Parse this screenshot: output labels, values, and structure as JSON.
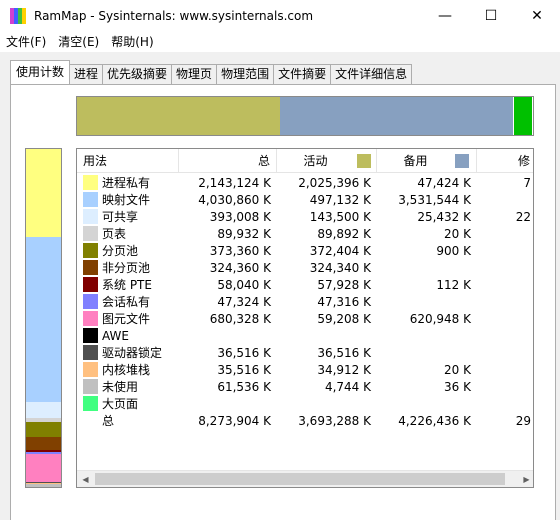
{
  "window": {
    "title": "RamMap - Sysinternals: www.sysinternals.com",
    "minimize": "—",
    "maximize": "☐",
    "close": "✕"
  },
  "menu": [
    "文件(F)",
    "清空(E)",
    "帮助(H)"
  ],
  "tabs": [
    "使用计数",
    "进程",
    "优先级摘要",
    "物理页",
    "物理范围",
    "文件摘要",
    "文件详细信息"
  ],
  "active_tab": 0,
  "grid": {
    "headers": {
      "usage": "用法",
      "total": "总",
      "active": "活动",
      "standby": "备用",
      "modified": "修"
    },
    "active_color": "#bdbd5e",
    "standby_color": "#87a0c0",
    "rows": [
      {
        "name": "进程私有",
        "color": "#ffff80",
        "total": "2,143,124 K",
        "active": "2,025,396 K",
        "standby": "47,424 K",
        "modified": "7"
      },
      {
        "name": "映射文件",
        "color": "#a8d0ff",
        "total": "4,030,860 K",
        "active": "497,132 K",
        "standby": "3,531,544 K",
        "modified": ""
      },
      {
        "name": "可共享",
        "color": "#ddeeff",
        "total": "393,008 K",
        "active": "143,500 K",
        "standby": "25,432 K",
        "modified": "22"
      },
      {
        "name": "页表",
        "color": "#d4d4d4",
        "total": "89,932 K",
        "active": "89,892 K",
        "standby": "20 K",
        "modified": ""
      },
      {
        "name": "分页池",
        "color": "#808000",
        "total": "373,360 K",
        "active": "372,404 K",
        "standby": "900 K",
        "modified": ""
      },
      {
        "name": "非分页池",
        "color": "#804000",
        "total": "324,360 K",
        "active": "324,340 K",
        "standby": "",
        "modified": ""
      },
      {
        "name": "系统 PTE",
        "color": "#800000",
        "total": "58,040 K",
        "active": "57,928 K",
        "standby": "112 K",
        "modified": ""
      },
      {
        "name": "会话私有",
        "color": "#8080ff",
        "total": "47,324 K",
        "active": "47,316 K",
        "standby": "",
        "modified": ""
      },
      {
        "name": "图元文件",
        "color": "#ff80c0",
        "total": "680,328 K",
        "active": "59,208 K",
        "standby": "620,948 K",
        "modified": ""
      },
      {
        "name": "AWE",
        "color": "#000000",
        "total": "",
        "active": "",
        "standby": "",
        "modified": ""
      },
      {
        "name": "驱动器锁定",
        "color": "#505050",
        "total": "36,516 K",
        "active": "36,516 K",
        "standby": "",
        "modified": ""
      },
      {
        "name": "内核堆栈",
        "color": "#ffc080",
        "total": "35,516 K",
        "active": "34,912 K",
        "standby": "20 K",
        "modified": ""
      },
      {
        "name": "未使用",
        "color": "#c0c0c0",
        "total": "61,536 K",
        "active": "4,744 K",
        "standby": "36 K",
        "modified": ""
      },
      {
        "name": "大页面",
        "color": "#40ff80",
        "total": "",
        "active": "",
        "standby": "",
        "modified": ""
      },
      {
        "name": "总",
        "color": "",
        "total": "8,273,904 K",
        "active": "3,693,288 K",
        "standby": "4,226,436 K",
        "modified": "29"
      }
    ]
  },
  "top_bar": [
    {
      "name": "active",
      "color": "#bdbd5e",
      "fraction": 0.446
    },
    {
      "name": "standby",
      "color": "#87a0c0",
      "fraction": 0.511
    },
    {
      "name": "modified",
      "color": "#ffffff",
      "fraction": 0.003
    },
    {
      "name": "free",
      "color": "#00c000",
      "fraction": 0.04
    }
  ],
  "left_bar": [
    {
      "name": "进程私有",
      "color": "#ffff80",
      "fraction": 0.259
    },
    {
      "name": "映射文件",
      "color": "#a8d0ff",
      "fraction": 0.487
    },
    {
      "name": "可共享",
      "color": "#ddeeff",
      "fraction": 0.048
    },
    {
      "name": "页表",
      "color": "#d4d4d4",
      "fraction": 0.011
    },
    {
      "name": "分页池",
      "color": "#808000",
      "fraction": 0.045
    },
    {
      "name": "非分页池",
      "color": "#804000",
      "fraction": 0.039
    },
    {
      "name": "系统 PTE",
      "color": "#800000",
      "fraction": 0.007
    },
    {
      "name": "会话私有",
      "color": "#8080ff",
      "fraction": 0.006
    },
    {
      "name": "图元文件",
      "color": "#ff80c0",
      "fraction": 0.082
    },
    {
      "name": "驱动器锁定",
      "color": "#505050",
      "fraction": 0.004
    },
    {
      "name": "内核堆栈",
      "color": "#ffc080",
      "fraction": 0.004
    },
    {
      "name": "未使用",
      "color": "#c0c0c0",
      "fraction": 0.008
    }
  ]
}
